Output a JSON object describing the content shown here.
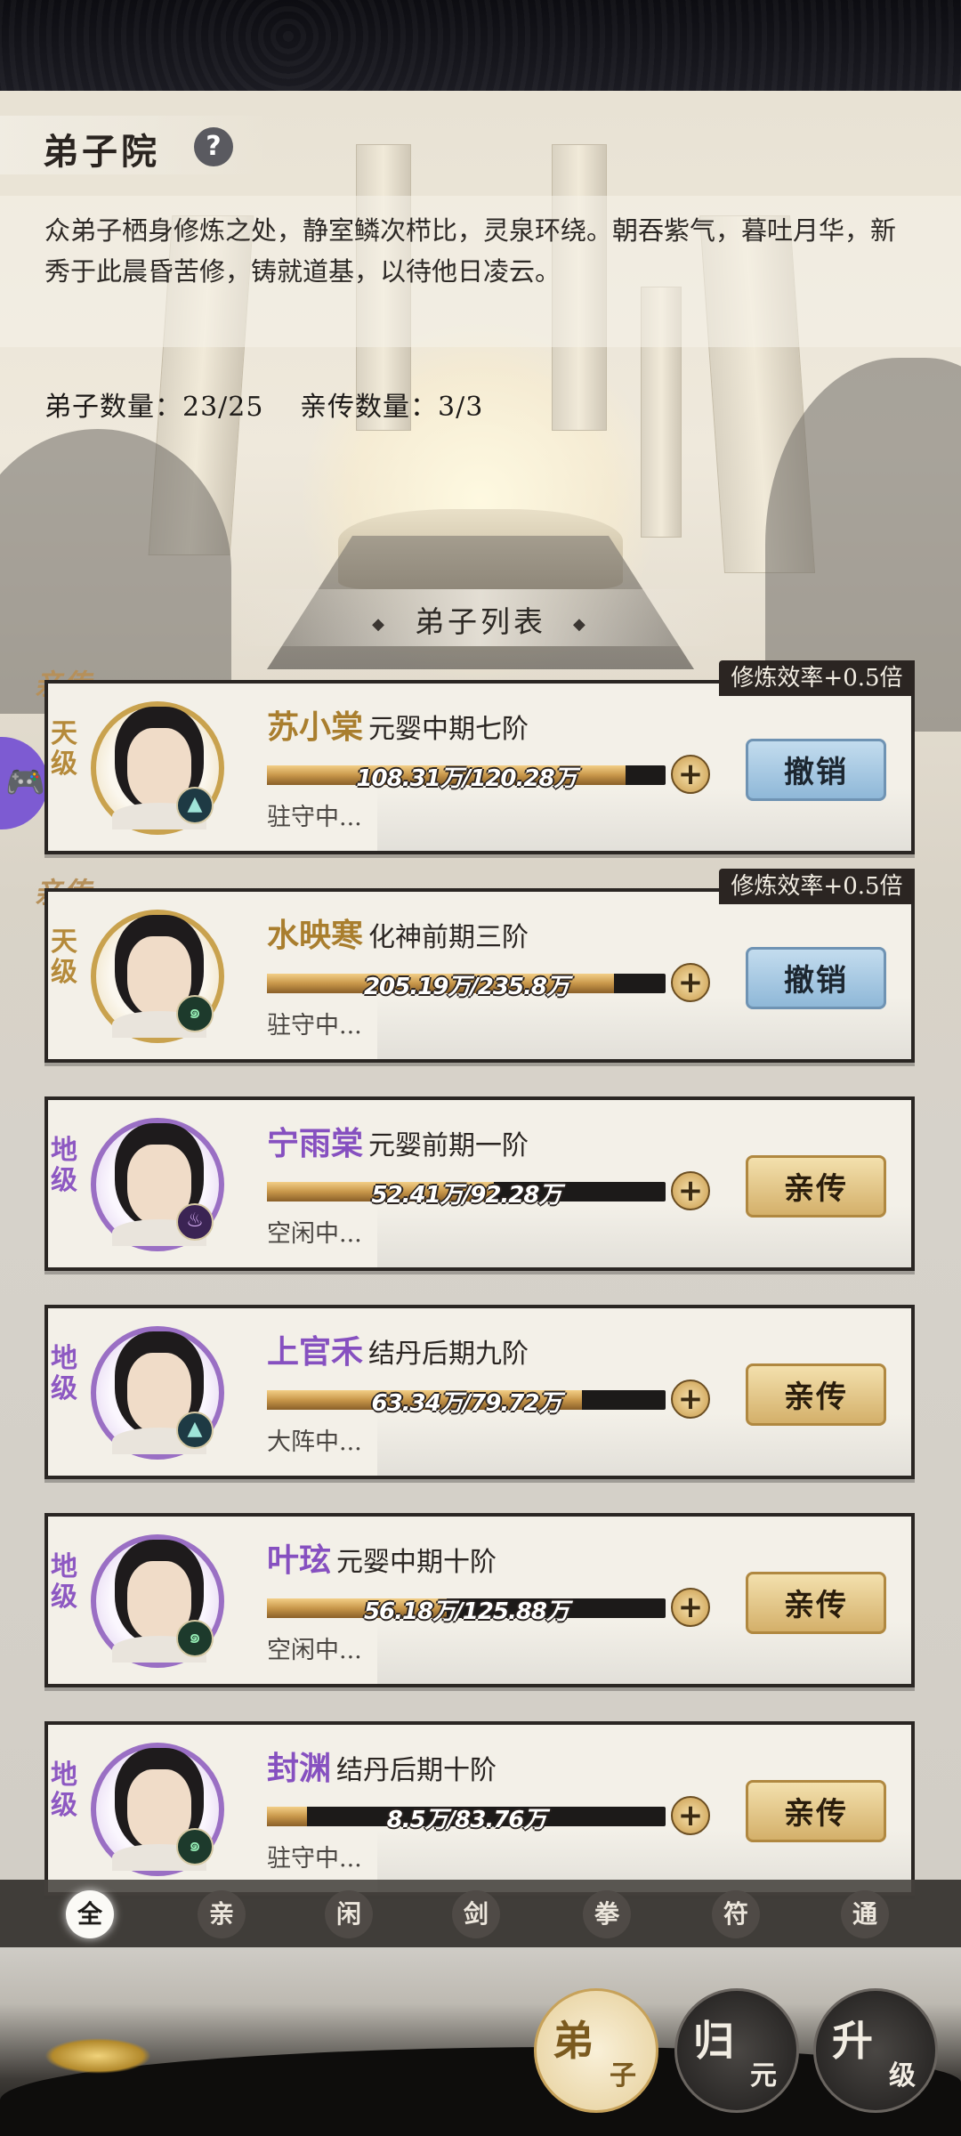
{
  "header": {
    "title": "弟子院",
    "help_icon": "question-icon",
    "description": "众弟子栖身修炼之处，静室鳞次栉比，灵泉环绕。朝吞紫气，暮吐月华，新秀于此晨昏苦修，铸就道基，以待他日凌云。",
    "disciple_count": "弟子数量：23/25",
    "core_count": "亲传数量：3/3"
  },
  "list": {
    "title": "弟子列表",
    "items": [
      {
        "tag": "亲传",
        "bonus": "修炼效率+0.5倍",
        "grade": "天级",
        "name": "苏小棠",
        "realm": "元婴中期七阶",
        "progress": "108.31万/120.28万",
        "progress_ratio": 0.9,
        "status": "驻守中...",
        "action": "撤销",
        "element": "water-element-icon"
      },
      {
        "tag": "亲传",
        "bonus": "修炼效率+0.5倍",
        "grade": "天级",
        "name": "水映寒",
        "realm": "化神前期三阶",
        "progress": "205.19万/235.8万",
        "progress_ratio": 0.87,
        "status": "驻守中...",
        "action": "撤销",
        "element": "wind-element-icon"
      },
      {
        "tag": "",
        "bonus": "",
        "grade": "地级",
        "name": "宁雨棠",
        "realm": "元婴前期一阶",
        "progress": "52.41万/92.28万",
        "progress_ratio": 0.57,
        "status": "空闲中...",
        "action": "亲传",
        "element": "fire-element-icon"
      },
      {
        "tag": "",
        "bonus": "",
        "grade": "地级",
        "name": "上官禾",
        "realm": "结丹后期九阶",
        "progress": "63.34万/79.72万",
        "progress_ratio": 0.79,
        "status": "大阵中...",
        "action": "亲传",
        "element": "water-element-icon"
      },
      {
        "tag": "",
        "bonus": "",
        "grade": "地级",
        "name": "叶玹",
        "realm": "元婴中期十阶",
        "progress": "56.18万/125.88万",
        "progress_ratio": 0.45,
        "status": "空闲中...",
        "action": "亲传",
        "element": "wind-element-icon"
      },
      {
        "tag": "",
        "bonus": "",
        "grade": "地级",
        "name": "封渊",
        "realm": "结丹后期十阶",
        "progress": "8.5万/83.76万",
        "progress_ratio": 0.1,
        "status": "驻守中...",
        "action": "亲传",
        "element": "wind-element-icon"
      }
    ]
  },
  "filters": [
    "全",
    "亲",
    "闲",
    "剑",
    "拳",
    "符",
    "通"
  ],
  "bottom_nav": [
    {
      "main": "弟",
      "sub": "子"
    },
    {
      "main": "归",
      "sub": "元"
    },
    {
      "main": "升",
      "sub": "级"
    }
  ],
  "colors": {
    "gold": "#c9a24e",
    "purple": "#9a6fc4",
    "revoke": "#8fb8d8",
    "core": "#d4b06a"
  }
}
